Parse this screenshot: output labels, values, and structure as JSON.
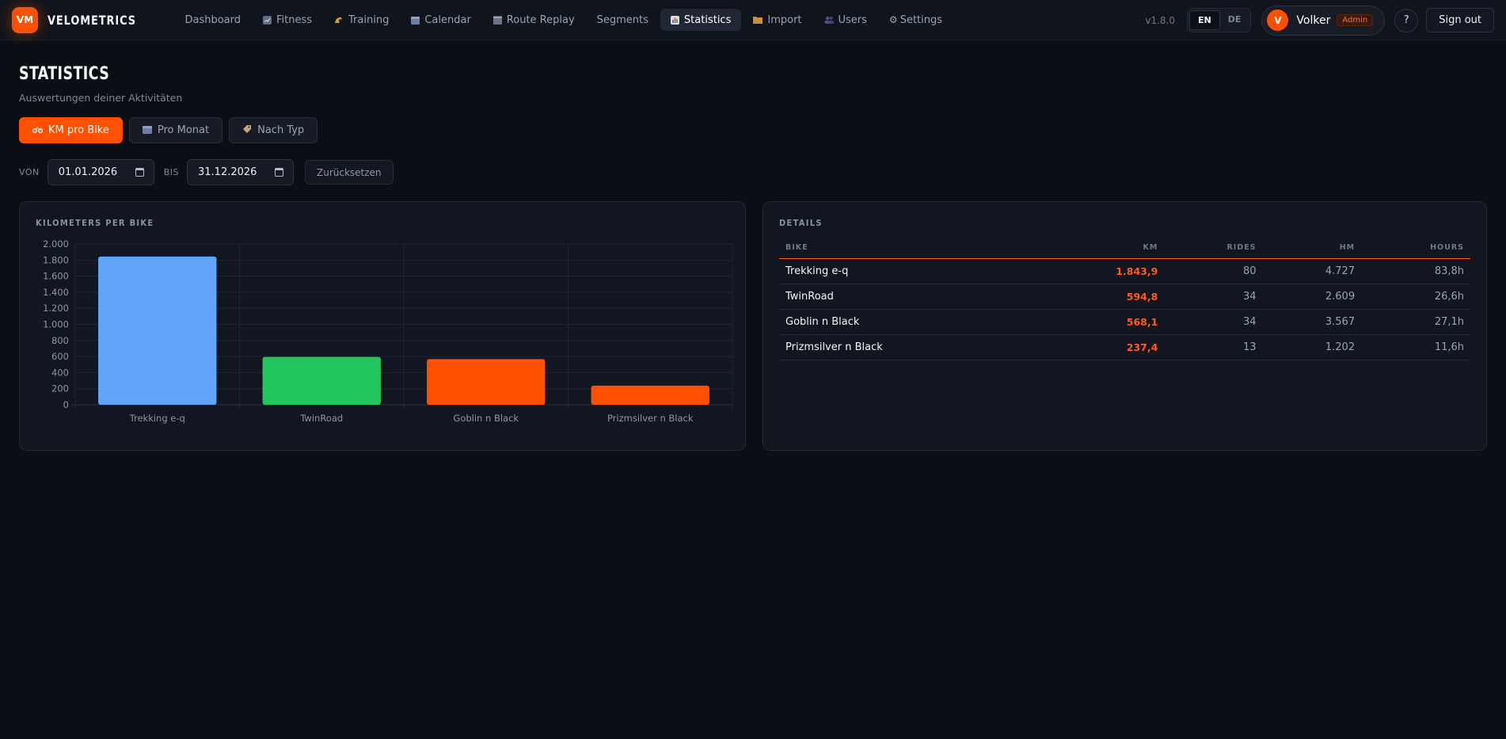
{
  "brand": {
    "badge": "VM",
    "name": "VELOMETRICS"
  },
  "nav": {
    "items": [
      {
        "label": "Dashboard",
        "icon": ""
      },
      {
        "label": "Fitness",
        "icon": "chart-icon"
      },
      {
        "label": "Training",
        "icon": "muscle-icon"
      },
      {
        "label": "Calendar",
        "icon": "calendar-icon"
      },
      {
        "label": "Route Replay",
        "icon": "clapper-icon"
      },
      {
        "label": "Segments",
        "icon": ""
      },
      {
        "label": "Statistics",
        "icon": "bar-chart-icon",
        "active": true
      },
      {
        "label": "Import",
        "icon": "folder-icon"
      },
      {
        "label": "Users",
        "icon": "users-icon"
      },
      {
        "label": "Settings",
        "icon": "gear-icon"
      }
    ],
    "version": "v1.8.0",
    "lang": [
      "EN",
      "DE"
    ],
    "user": {
      "initial": "V",
      "name": "Volker",
      "role": "Admin"
    },
    "help": "?",
    "signout": "Sign out"
  },
  "page": {
    "title": "STATISTICS",
    "subtitle": "Auswertungen deiner Aktivitäten",
    "tabs": [
      {
        "label": "KM pro Bike",
        "icon": "bike-icon",
        "active": true
      },
      {
        "label": "Pro Monat",
        "icon": "calendar-icon"
      },
      {
        "label": "Nach Typ",
        "icon": "tag-icon"
      }
    ],
    "filters": {
      "from_label": "VON",
      "from_value": "01.01.2026",
      "to_label": "BIS",
      "to_value": "31.12.2026",
      "reset": "Zurücksetzen"
    }
  },
  "chart_card": {
    "title": "KILOMETERS PER BIKE"
  },
  "chart_data": {
    "type": "bar",
    "categories": [
      "Trekking e-q",
      "TwinRoad",
      "Goblin n Black",
      "Prizmsilver n Black"
    ],
    "values": [
      1843.9,
      594.8,
      568.1,
      237.4
    ],
    "colors": [
      "#60a5fa",
      "#22c55e",
      "#ff4f00",
      "#ff4f00"
    ],
    "ylim": [
      0,
      2000
    ],
    "yticks": [
      "0",
      "200",
      "400",
      "600",
      "800",
      "1.000",
      "1.200",
      "1.400",
      "1.600",
      "1.800",
      "2.000"
    ],
    "title": "KILOMETERS PER BIKE",
    "grid": true
  },
  "details": {
    "title": "DETAILS",
    "columns": [
      "BIKE",
      "KM",
      "RIDES",
      "HM",
      "HOURS"
    ],
    "rows": [
      [
        "Trekking e-q",
        "1.843,9",
        "80",
        "4.727",
        "83,8h"
      ],
      [
        "TwinRoad",
        "594,8",
        "34",
        "2.609",
        "26,6h"
      ],
      [
        "Goblin n Black",
        "568,1",
        "34",
        "3.567",
        "27,1h"
      ],
      [
        "Prizmsilver n Black",
        "237,4",
        "13",
        "1.202",
        "11,6h"
      ]
    ]
  },
  "colors": {
    "accent": "#ff4f00",
    "background": "#0b0e15",
    "card": "#111620"
  }
}
